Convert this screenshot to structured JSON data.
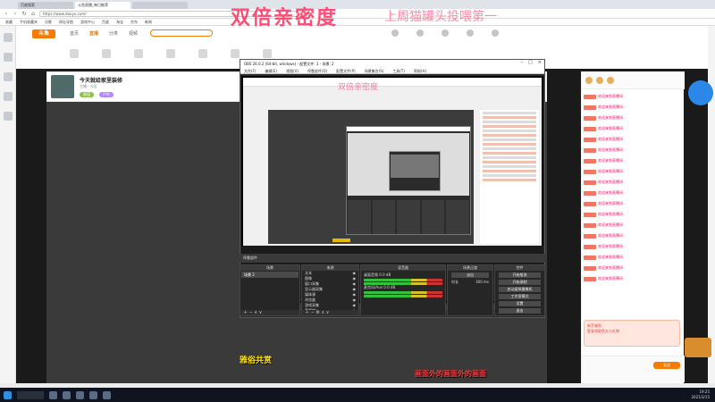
{
  "browser": {
    "tabs": [
      {
        "label": "百度搜索"
      },
      {
        "label": "斗鱼直播_每日推荐"
      },
      {
        "label": ""
      }
    ],
    "url": "https://www.douyu.com/",
    "bookmarks": [
      "收藏",
      "手机收藏夹",
      "谷歌",
      "网址导航",
      "游戏中心",
      "百度",
      "淘宝",
      "京东",
      "新闻"
    ]
  },
  "site": {
    "logo": "斗鱼",
    "nav": [
      "首页",
      "直播",
      "分类",
      "视频"
    ],
    "active_nav": "直播"
  },
  "stream": {
    "title": "今天就给家里装修",
    "meta": "主播 · 分区",
    "tags": [
      "颜值",
      "户外"
    ]
  },
  "obs": {
    "title": "OBS 26.0.2 (64-bit, windows) - 配置文件: 1 - 场景: 2",
    "menu": [
      "文件(F)",
      "编辑(E)",
      "视图(V)",
      "停靠部件(D)",
      "配置文件(P)",
      "场景集合(S)",
      "工具(T)",
      "帮助(H)"
    ],
    "docks_label": "停靠部件",
    "scene_dock": "场景",
    "scenes": [
      "场景 2"
    ],
    "source_dock": "来源",
    "sources": [
      "文本",
      "图像",
      "窗口采集",
      "显示器采集",
      "媒体源",
      "浏览器",
      "游戏采集",
      "音频输入"
    ],
    "mixer_dock": "混音器",
    "mixer": [
      {
        "name": "桌面音频",
        "db": "0.0 dB"
      },
      {
        "name": "麦克风/Aux",
        "db": "0.0 dB"
      }
    ],
    "transition_dock": "场景过渡",
    "transition_value": "淡出",
    "duration_label": "时长",
    "duration_value": "300 ms",
    "controls_dock": "控件",
    "controls": [
      "开始推流",
      "开始录制",
      "启动虚拟摄像机",
      "工作室模式",
      "设置",
      "退出"
    ]
  },
  "overlays": {
    "watermark": "双倍亲密度",
    "watermark_tail": "上周猫罐头投喂第一",
    "watermark_small": "双倍亲密度",
    "subtitle_yellow": "雅俗共赏",
    "subtitle_red": "画面外的画面外的画面"
  },
  "chat": {
    "lines": [
      "欢迎来到直播间",
      "欢迎来到直播间",
      "欢迎来到直播间",
      "欢迎来到直播间",
      "欢迎来到直播间",
      "欢迎来到直播间",
      "欢迎来到直播间",
      "欢迎来到直播间",
      "欢迎来到直播间",
      "欢迎来到直播间",
      "欢迎来到直播间",
      "欢迎来到直播间",
      "欢迎来到直播间",
      "欢迎来到直播间",
      "欢迎来到直播间",
      "欢迎来到直播间",
      "欢迎来到直播间",
      "欢迎来到直播间"
    ],
    "promo_title": "新手福利",
    "promo_text": "登录领取鱼丸与礼物",
    "send_label": "发送"
  },
  "taskbar": {
    "time": "19:25",
    "date": "2021/3/15"
  }
}
